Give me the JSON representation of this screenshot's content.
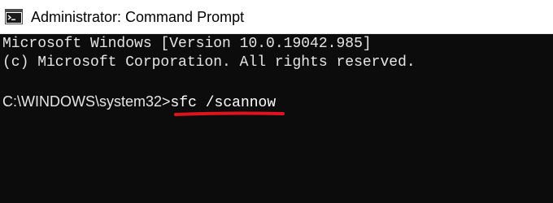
{
  "window": {
    "title": "Administrator: Command Prompt",
    "icon": "cmd-console-icon"
  },
  "console": {
    "lines": [
      "Microsoft Windows [Version 10.0.19042.985]",
      "(c) Microsoft Corporation. All rights reserved."
    ],
    "prompt": "C:\\WINDOWS\\system32>",
    "command": "sfc /scannow"
  },
  "colors": {
    "console_background": "#0c0c0c",
    "console_text": "#e6e6e6",
    "highlight_underline": "#e0141e",
    "titlebar_background": "#ffffff"
  }
}
